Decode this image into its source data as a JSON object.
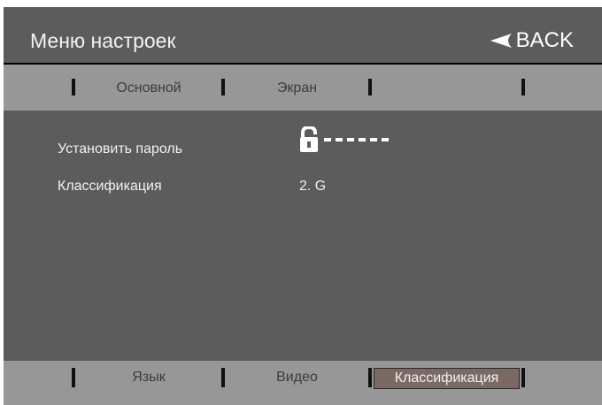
{
  "header": {
    "title": "Меню настроек",
    "back_label": "BACK"
  },
  "top_tabs": [
    "Основной",
    "Экран",
    "",
    ""
  ],
  "settings": [
    {
      "label": "Установить пароль",
      "value_icon": "lock-open-icon",
      "value": "------"
    },
    {
      "label": "Классификация",
      "value": "2. G"
    }
  ],
  "bottom_tabs": [
    "Язык",
    "Видео",
    "Классификация"
  ],
  "selected_bottom_tab": "Классификация",
  "colors": {
    "panel": "#5c5c5c",
    "tab_bar": "#979797",
    "selected_tab": "#7b6a64",
    "text": "#f0f0f0"
  }
}
